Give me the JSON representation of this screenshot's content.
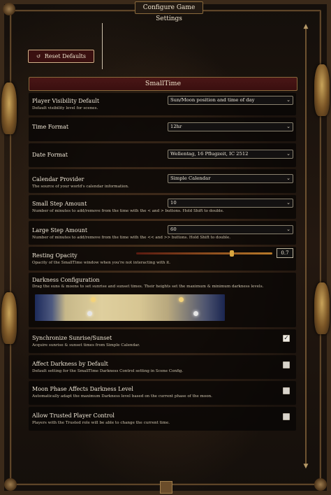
{
  "window": {
    "title": "Configure Game Settings"
  },
  "toolbar": {
    "reset_label": "Reset Defaults",
    "reset_icon": "undo-icon"
  },
  "section": {
    "title": "SmallTime"
  },
  "settings": {
    "player_visibility": {
      "label": "Player Visibility Default",
      "hint": "Default visibility level for scenes.",
      "value": "Sun/Moon position and time of day"
    },
    "time_format": {
      "label": "Time Format",
      "value": "12hr"
    },
    "date_format": {
      "label": "Date Format",
      "value": "Wellentag, 16 Pflugzeit, IC 2512"
    },
    "calendar_provider": {
      "label": "Calendar Provider",
      "hint": "The source of your world's calendar information.",
      "value": "Simple Calendar"
    },
    "small_step": {
      "label": "Small Step Amount",
      "hint": "Number of minutes to add/remove from the time with the < and > buttons. Hold Shift to double.",
      "value": "10"
    },
    "large_step": {
      "label": "Large Step Amount",
      "hint": "Number of minutes to add/remove from the time with the << and >> buttons. Hold Shift to double.",
      "value": "60"
    },
    "resting_opacity": {
      "label": "Resting Opacity",
      "hint": "Opacity of the SmallTime window when you're not interacting with it.",
      "value": "0.7",
      "fraction": 0.7
    },
    "darkness": {
      "label": "Darkness Configuration",
      "hint": "Drag the suns & moons to set sunrise and sunset times. Their heights set the maximum & minimum darkness levels."
    },
    "sync_sunrise": {
      "label": "Synchronize Sunrise/Sunset",
      "hint": "Acquire sunrise & sunset times from Simple Calendar.",
      "checked": true,
      "check_glyph": "✓"
    },
    "affect_darkness": {
      "label": "Affect Darkness by Default",
      "hint": "Default setting for the SmallTime Darkness Control setting in Scene Config.",
      "checked": false
    },
    "moon_phase": {
      "label": "Moon Phase Affects Darkness Level",
      "hint": "Automatically adapt the maximum Darkness level based on the current phase of the moon.",
      "checked": false
    },
    "trusted_control": {
      "label": "Allow Trusted Player Control",
      "hint": "Players with the Trusted role will be able to change the current time.",
      "checked": false
    }
  },
  "glyphs": {
    "chevron": "⌄",
    "undo": "↺",
    "up": "▲",
    "down": "▼"
  }
}
